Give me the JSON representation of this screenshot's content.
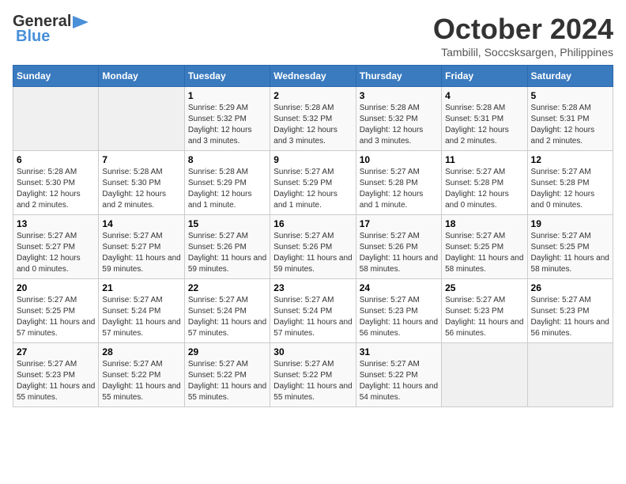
{
  "logo": {
    "text1": "General",
    "text2": "Blue"
  },
  "title": "October 2024",
  "location": "Tambilil, Soccsksargen, Philippines",
  "headers": [
    "Sunday",
    "Monday",
    "Tuesday",
    "Wednesday",
    "Thursday",
    "Friday",
    "Saturday"
  ],
  "weeks": [
    [
      {
        "day": "",
        "sunrise": "",
        "sunset": "",
        "daylight": ""
      },
      {
        "day": "",
        "sunrise": "",
        "sunset": "",
        "daylight": ""
      },
      {
        "day": "1",
        "sunrise": "Sunrise: 5:29 AM",
        "sunset": "Sunset: 5:32 PM",
        "daylight": "Daylight: 12 hours and 3 minutes."
      },
      {
        "day": "2",
        "sunrise": "Sunrise: 5:28 AM",
        "sunset": "Sunset: 5:32 PM",
        "daylight": "Daylight: 12 hours and 3 minutes."
      },
      {
        "day": "3",
        "sunrise": "Sunrise: 5:28 AM",
        "sunset": "Sunset: 5:32 PM",
        "daylight": "Daylight: 12 hours and 3 minutes."
      },
      {
        "day": "4",
        "sunrise": "Sunrise: 5:28 AM",
        "sunset": "Sunset: 5:31 PM",
        "daylight": "Daylight: 12 hours and 2 minutes."
      },
      {
        "day": "5",
        "sunrise": "Sunrise: 5:28 AM",
        "sunset": "Sunset: 5:31 PM",
        "daylight": "Daylight: 12 hours and 2 minutes."
      }
    ],
    [
      {
        "day": "6",
        "sunrise": "Sunrise: 5:28 AM",
        "sunset": "Sunset: 5:30 PM",
        "daylight": "Daylight: 12 hours and 2 minutes."
      },
      {
        "day": "7",
        "sunrise": "Sunrise: 5:28 AM",
        "sunset": "Sunset: 5:30 PM",
        "daylight": "Daylight: 12 hours and 2 minutes."
      },
      {
        "day": "8",
        "sunrise": "Sunrise: 5:28 AM",
        "sunset": "Sunset: 5:29 PM",
        "daylight": "Daylight: 12 hours and 1 minute."
      },
      {
        "day": "9",
        "sunrise": "Sunrise: 5:27 AM",
        "sunset": "Sunset: 5:29 PM",
        "daylight": "Daylight: 12 hours and 1 minute."
      },
      {
        "day": "10",
        "sunrise": "Sunrise: 5:27 AM",
        "sunset": "Sunset: 5:28 PM",
        "daylight": "Daylight: 12 hours and 1 minute."
      },
      {
        "day": "11",
        "sunrise": "Sunrise: 5:27 AM",
        "sunset": "Sunset: 5:28 PM",
        "daylight": "Daylight: 12 hours and 0 minutes."
      },
      {
        "day": "12",
        "sunrise": "Sunrise: 5:27 AM",
        "sunset": "Sunset: 5:28 PM",
        "daylight": "Daylight: 12 hours and 0 minutes."
      }
    ],
    [
      {
        "day": "13",
        "sunrise": "Sunrise: 5:27 AM",
        "sunset": "Sunset: 5:27 PM",
        "daylight": "Daylight: 12 hours and 0 minutes."
      },
      {
        "day": "14",
        "sunrise": "Sunrise: 5:27 AM",
        "sunset": "Sunset: 5:27 PM",
        "daylight": "Daylight: 11 hours and 59 minutes."
      },
      {
        "day": "15",
        "sunrise": "Sunrise: 5:27 AM",
        "sunset": "Sunset: 5:26 PM",
        "daylight": "Daylight: 11 hours and 59 minutes."
      },
      {
        "day": "16",
        "sunrise": "Sunrise: 5:27 AM",
        "sunset": "Sunset: 5:26 PM",
        "daylight": "Daylight: 11 hours and 59 minutes."
      },
      {
        "day": "17",
        "sunrise": "Sunrise: 5:27 AM",
        "sunset": "Sunset: 5:26 PM",
        "daylight": "Daylight: 11 hours and 58 minutes."
      },
      {
        "day": "18",
        "sunrise": "Sunrise: 5:27 AM",
        "sunset": "Sunset: 5:25 PM",
        "daylight": "Daylight: 11 hours and 58 minutes."
      },
      {
        "day": "19",
        "sunrise": "Sunrise: 5:27 AM",
        "sunset": "Sunset: 5:25 PM",
        "daylight": "Daylight: 11 hours and 58 minutes."
      }
    ],
    [
      {
        "day": "20",
        "sunrise": "Sunrise: 5:27 AM",
        "sunset": "Sunset: 5:25 PM",
        "daylight": "Daylight: 11 hours and 57 minutes."
      },
      {
        "day": "21",
        "sunrise": "Sunrise: 5:27 AM",
        "sunset": "Sunset: 5:24 PM",
        "daylight": "Daylight: 11 hours and 57 minutes."
      },
      {
        "day": "22",
        "sunrise": "Sunrise: 5:27 AM",
        "sunset": "Sunset: 5:24 PM",
        "daylight": "Daylight: 11 hours and 57 minutes."
      },
      {
        "day": "23",
        "sunrise": "Sunrise: 5:27 AM",
        "sunset": "Sunset: 5:24 PM",
        "daylight": "Daylight: 11 hours and 57 minutes."
      },
      {
        "day": "24",
        "sunrise": "Sunrise: 5:27 AM",
        "sunset": "Sunset: 5:23 PM",
        "daylight": "Daylight: 11 hours and 56 minutes."
      },
      {
        "day": "25",
        "sunrise": "Sunrise: 5:27 AM",
        "sunset": "Sunset: 5:23 PM",
        "daylight": "Daylight: 11 hours and 56 minutes."
      },
      {
        "day": "26",
        "sunrise": "Sunrise: 5:27 AM",
        "sunset": "Sunset: 5:23 PM",
        "daylight": "Daylight: 11 hours and 56 minutes."
      }
    ],
    [
      {
        "day": "27",
        "sunrise": "Sunrise: 5:27 AM",
        "sunset": "Sunset: 5:23 PM",
        "daylight": "Daylight: 11 hours and 55 minutes."
      },
      {
        "day": "28",
        "sunrise": "Sunrise: 5:27 AM",
        "sunset": "Sunset: 5:22 PM",
        "daylight": "Daylight: 11 hours and 55 minutes."
      },
      {
        "day": "29",
        "sunrise": "Sunrise: 5:27 AM",
        "sunset": "Sunset: 5:22 PM",
        "daylight": "Daylight: 11 hours and 55 minutes."
      },
      {
        "day": "30",
        "sunrise": "Sunrise: 5:27 AM",
        "sunset": "Sunset: 5:22 PM",
        "daylight": "Daylight: 11 hours and 55 minutes."
      },
      {
        "day": "31",
        "sunrise": "Sunrise: 5:27 AM",
        "sunset": "Sunset: 5:22 PM",
        "daylight": "Daylight: 11 hours and 54 minutes."
      },
      {
        "day": "",
        "sunrise": "",
        "sunset": "",
        "daylight": ""
      },
      {
        "day": "",
        "sunrise": "",
        "sunset": "",
        "daylight": ""
      }
    ]
  ]
}
